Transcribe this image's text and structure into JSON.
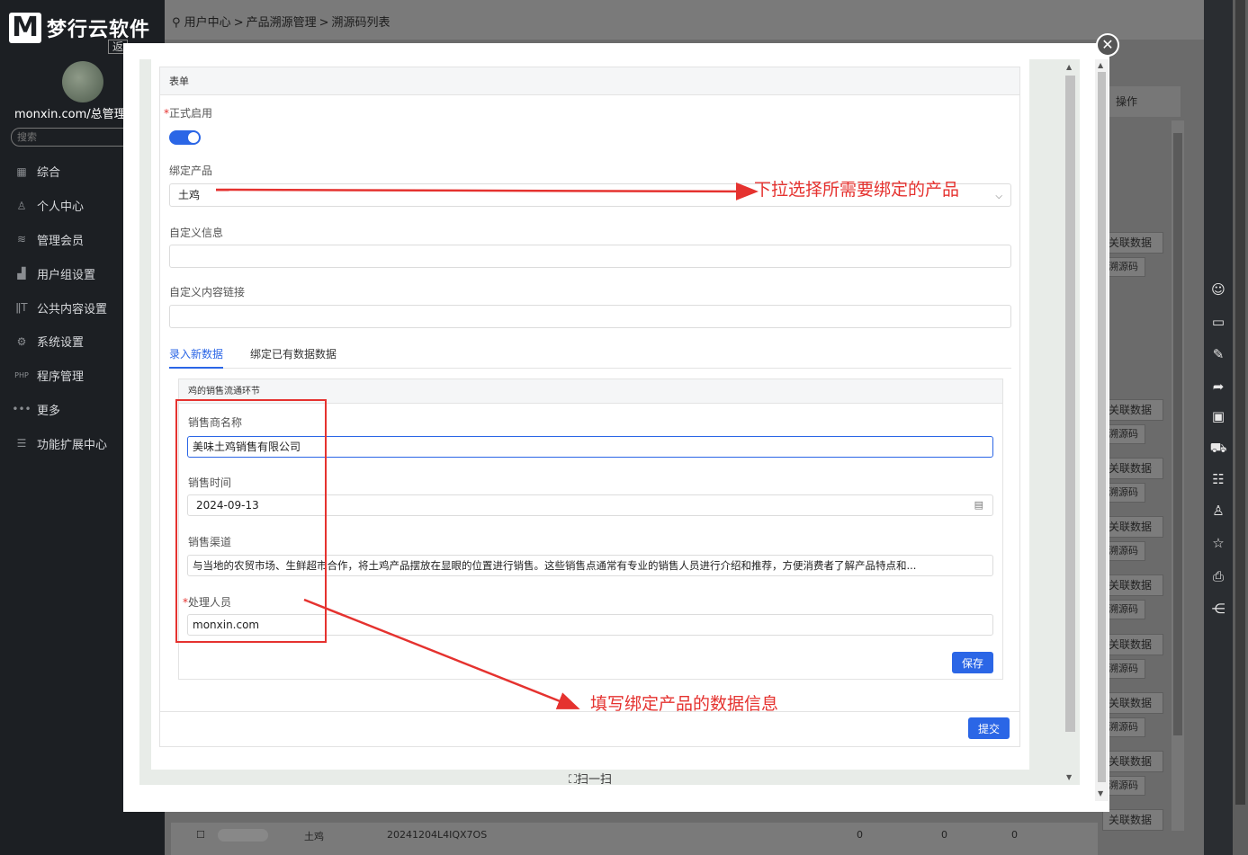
{
  "sidebar": {
    "logo_letter": "M",
    "logo_text": "梦行云软件",
    "back_label": "返",
    "username": "monxin.com/总管理",
    "search_placeholder": "搜索",
    "items": [
      {
        "label": "综合",
        "icon": "grid-icon"
      },
      {
        "label": "个人中心",
        "icon": "user-icon"
      },
      {
        "label": "管理会员",
        "icon": "layers-icon"
      },
      {
        "label": "用户组设置",
        "icon": "group-icon"
      },
      {
        "label": "公共内容设置",
        "icon": "text-icon"
      },
      {
        "label": "系统设置",
        "icon": "gear-icon"
      },
      {
        "label": "程序管理",
        "icon": "php-icon"
      },
      {
        "label": "更多",
        "icon": "more-icon"
      },
      {
        "label": "功能扩展中心",
        "icon": "menu-icon"
      }
    ]
  },
  "breadcrumb": {
    "items": [
      "用户中心",
      "产品溯源管理",
      "溯源码列表"
    ],
    "separator": ">"
  },
  "background_table": {
    "op_header": "操作",
    "row_btn_primary": "关联数据",
    "row_btn_secondary": "溯源码",
    "bottom_row": {
      "product": "土鸡",
      "code": "20241204L4IQX7OS",
      "c1": "0",
      "c2": "0",
      "c3": "0"
    }
  },
  "modal": {
    "close_symbol": "✕",
    "card_title": "表单",
    "active_label": "正式启用",
    "active_on": true,
    "bind_product_label": "绑定产品",
    "bind_product_value": "土鸡",
    "custom_info_label": "自定义信息",
    "custom_info_value": "",
    "custom_link_label": "自定义内容链接",
    "custom_link_value": "",
    "tabs": [
      "录入新数据",
      "绑定已有数据数据"
    ],
    "active_tab": 0,
    "subcard_title": "鸡的销售流通环节",
    "fields": {
      "seller_label": "销售商名称",
      "seller_value": "美味土鸡销售有限公司",
      "time_label": "销售时间",
      "time_value": "2024-09-13",
      "channel_label": "销售渠道",
      "channel_value": "与当地的农贸市场、生鲜超市合作，将土鸡产品摆放在显眼的位置进行销售。这些销售点通常有专业的销售人员进行介绍和推荐，方便消费者了解产品特点和...",
      "handler_label": "处理人员",
      "handler_value": "monxin.com"
    },
    "save_label": "保存",
    "submit_label": "提交",
    "scan_label": "扫一扫"
  },
  "annotations": {
    "dropdown_hint": "下拉选择所需要绑定的产品",
    "fill_hint": "填写绑定产品的数据信息"
  },
  "colors": {
    "accent": "#2b66e6",
    "annotation_red": "#e5322f",
    "sidebar_bg": "#1c1f23"
  }
}
